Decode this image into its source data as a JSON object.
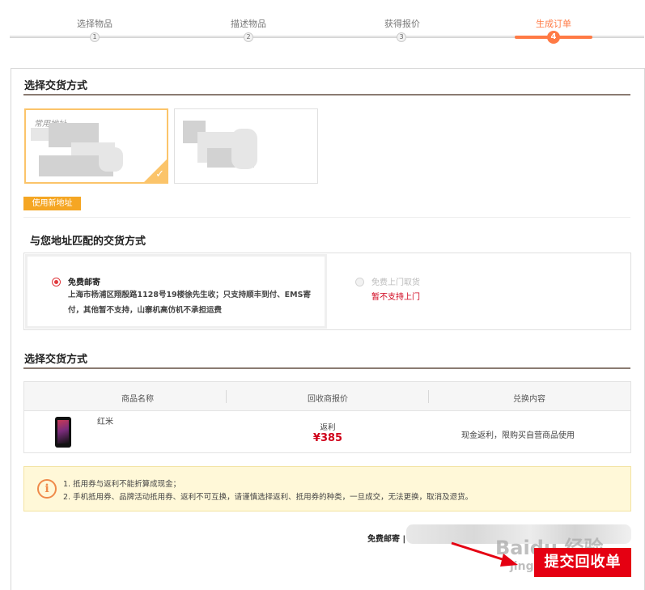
{
  "steps": [
    {
      "num": "1",
      "label": "选择物品"
    },
    {
      "num": "2",
      "label": "描述物品"
    },
    {
      "num": "3",
      "label": "获得报价"
    },
    {
      "num": "4",
      "label": "生成订单"
    }
  ],
  "active_step": 4,
  "address_section": {
    "title": "选择交货方式",
    "card_tag": "常用地址",
    "new_address_button": "使用新地址"
  },
  "delivery_section": {
    "title": "与您地址匹配的交货方式",
    "option_free_post": {
      "title": "免费邮寄",
      "desc_line1": "上海市杨浦区翔殷路1128号19楼徐先生收；只支持顺丰到付、EMS寄",
      "desc_line2": "付，其他暂不支持，山寨机高仿机不承担运费"
    },
    "option_pickup": {
      "title": "免费上门取货",
      "warning": "暂不支持上门"
    }
  },
  "order_section": {
    "title": "选择交货方式",
    "columns": [
      "商品名称",
      "回收商报价",
      "兑换内容"
    ],
    "row": {
      "product_name": "红米",
      "rebate_label": "返利",
      "price": "¥385",
      "exchange_content": "现金返利，限购买自营商品使用"
    }
  },
  "notice": {
    "icon": "info-icon",
    "line1": "1. 抵用券与返利不能折算成现金；",
    "line2": "2. 手机抵用券、品牌活动抵用券、返利不可互换，请谨慎选择返利、抵用券的种类，一旦成交，无法更换，取消及退货。"
  },
  "footer": {
    "shipping_label": "免费邮寄 |",
    "submit_button": "提交回收单"
  },
  "watermark": {
    "text": "Baidu 经验",
    "url": "jingyan.baidu.com"
  },
  "colors": {
    "accent": "#ff7a45",
    "selected_border": "#fbc46a",
    "button_yellow": "#f5a623",
    "radio_red": "#e0393e",
    "price_red": "#d0021b",
    "submit_red": "#e50012"
  }
}
